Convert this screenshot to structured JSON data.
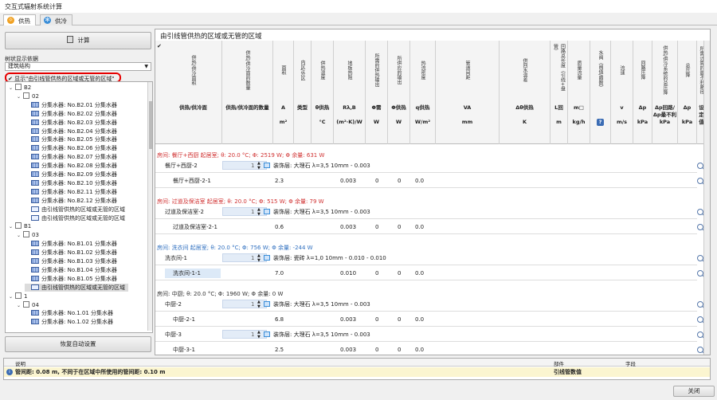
{
  "window": {
    "title": "交互式辐射系统计算"
  },
  "tabs": [
    {
      "label": "供热",
      "icon": "heating-icon",
      "color": "#f0a020"
    },
    {
      "label": "供冷",
      "icon": "snowflake-icon",
      "color": "#3b8ed8"
    }
  ],
  "left": {
    "calc_label": "计算",
    "display_label": "树状显示依据",
    "display_value": "建筑结构",
    "checkbox_label": "显示\"由引线管供热的区域或无管的区域\"",
    "restore_label": "恢复自动设置"
  },
  "tree": [
    {
      "level": 0,
      "icon": "floor",
      "label": "B2",
      "expanded": true
    },
    {
      "level": 1,
      "icon": "floor",
      "label": "02",
      "expanded": true
    },
    {
      "level": 2,
      "icon": "man",
      "label": "分集水器: No.B2.01 分集水器"
    },
    {
      "level": 2,
      "icon": "man",
      "label": "分集水器: No.B2.02 分集水器"
    },
    {
      "level": 2,
      "icon": "man",
      "label": "分集水器: No.B2.03 分集水器"
    },
    {
      "level": 2,
      "icon": "man",
      "label": "分集水器: No.B2.04 分集水器"
    },
    {
      "level": 2,
      "icon": "man",
      "label": "分集水器: No.B2.05 分集水器"
    },
    {
      "level": 2,
      "icon": "man",
      "label": "分集水器: No.B2.06 分集水器"
    },
    {
      "level": 2,
      "icon": "man",
      "label": "分集水器: No.B2.07 分集水器"
    },
    {
      "level": 2,
      "icon": "man",
      "label": "分集水器: No.B2.08 分集水器"
    },
    {
      "level": 2,
      "icon": "man",
      "label": "分集水器: No.B2.09 分集水器"
    },
    {
      "level": 2,
      "icon": "man",
      "label": "分集水器: No.B2.10 分集水器"
    },
    {
      "level": 2,
      "icon": "man",
      "label": "分集水器: No.B2.11 分集水器"
    },
    {
      "level": 2,
      "icon": "man",
      "label": "分集水器: No.B2.12 分集水器"
    },
    {
      "level": 2,
      "icon": "grp",
      "label": "由引线管供热的区域或无管的区域"
    },
    {
      "level": 2,
      "icon": "grp",
      "label": "由引线管供热的区域或无管的区域"
    },
    {
      "level": 0,
      "icon": "floor",
      "label": "B1",
      "expanded": true
    },
    {
      "level": 1,
      "icon": "floor",
      "label": "03",
      "expanded": true
    },
    {
      "level": 2,
      "icon": "man",
      "label": "分集水器: No.B1.01 分集水器"
    },
    {
      "level": 2,
      "icon": "man",
      "label": "分集水器: No.B1.02 分集水器"
    },
    {
      "level": 2,
      "icon": "man",
      "label": "分集水器: No.B1.03 分集水器"
    },
    {
      "level": 2,
      "icon": "man",
      "label": "分集水器: No.B1.04 分集水器"
    },
    {
      "level": 2,
      "icon": "man",
      "label": "分集水器: No.B1.05 分集水器"
    },
    {
      "level": 2,
      "icon": "grp",
      "label": "由引线管供热的区域或无管的区域",
      "selected": true
    },
    {
      "level": 0,
      "icon": "floor",
      "label": "1",
      "expanded": true
    },
    {
      "level": 1,
      "icon": "floor",
      "label": "04",
      "expanded": true
    },
    {
      "level": 2,
      "icon": "man",
      "label": "分集水器: No.1.01 分集水器"
    },
    {
      "level": 2,
      "icon": "man",
      "label": "分集水器: No.1.02 分集水器"
    }
  ],
  "main": {
    "title": "由引线管供热的区域或无管的区域"
  },
  "columns": [
    {
      "v": "供热/供冷面积",
      "s": "供热/供冷面",
      "u": ""
    },
    {
      "v": "供热/供冷面的数量",
      "s": "供热/供冷面的数量",
      "u": ""
    },
    {
      "v": "面积",
      "s": "A",
      "u": "m²"
    },
    {
      "v": "内区/外区",
      "s": "类型",
      "u": ""
    },
    {
      "v": "供热温度",
      "s": "θ供热",
      "u": "°C"
    },
    {
      "v": "地板热阻",
      "s": "Rλ,B",
      "u": "(m²·K)/W"
    },
    {
      "v": "所需的供热输出",
      "s": "Φ需",
      "u": "W"
    },
    {
      "v": "所供应的输出",
      "s": "Φ供热",
      "u": "W"
    },
    {
      "v": "热流密度",
      "s": "q供热",
      "u": "W/m²"
    },
    {
      "v": "管道间距",
      "s": "VA",
      "u": "mm"
    },
    {
      "v": "供回水温差",
      "s": "Δθ供热",
      "u": "K"
    },
    {
      "v": "回路总长度（引线+盘管）",
      "s": "L回",
      "u": "m"
    },
    {
      "v": "质量流量",
      "s": "m□",
      "u": "kg/h"
    },
    {
      "v": "水阀（阀值/圈数）",
      "s": "",
      "u": "?"
    },
    {
      "v": "流速",
      "s": "v",
      "u": "m/s"
    },
    {
      "v": "回路压降",
      "s": "Δp",
      "u": "kPa"
    },
    {
      "v": "供热/供冷系统的总压降",
      "s": "Δp回路/Δp最不利",
      "u": "kPa"
    },
    {
      "v": "总压降",
      "s": "Δp",
      "u": "kPa"
    },
    {
      "v": "所需计算的最不利路径",
      "s": "设定值",
      "u": ""
    }
  ],
  "rooms": [
    {
      "header": "房间: 餐厅+西厨 起居室; θ: 20.0 °C; Φ: 2519 W; Φ 余量: 631 W",
      "color": "#d03030",
      "rows": [
        {
          "name": "餐厅+西厨-2",
          "spin": "1",
          "mat": "装饰层: 大理石 λ=3,5 10mm - 0.003"
        },
        {
          "name": "餐厅+西厨-2-1",
          "area": "2.3",
          "r": "0.003",
          "a": "0",
          "b": "0",
          "c": "0.0"
        }
      ]
    },
    {
      "header": "房间: 过道及保洁室 起居室; θ: 20.0 °C; Φ: 515 W; Φ 余量: 79 W",
      "color": "#d03030",
      "rows": [
        {
          "name": "过道及保洁室-2",
          "spin": "1",
          "mat": "装饰层: 大理石 λ=3,5 10mm - 0.003"
        },
        {
          "name": "过道及保洁室-2-1",
          "area": "0.6",
          "r": "0.003",
          "a": "0",
          "b": "0",
          "c": "0.0"
        }
      ]
    },
    {
      "header": "房间: 洗衣间 起居室; θ: 20.0 °C; Φ: 756 W; Φ 余量: -244 W",
      "color": "#3070c0",
      "rows": [
        {
          "name": "洗衣间-1",
          "spin": "1",
          "mat": "装饰层: 瓷砖 λ=1,0 10mm - 0.010 - 0.010"
        },
        {
          "name": "洗衣间-1-1",
          "area": "7.0",
          "r": "0.010",
          "a": "0",
          "b": "0",
          "c": "0.0",
          "hl": true
        }
      ]
    },
    {
      "header": "房间: 中厨; θ: 20.0 °C; Φ: 1960 W; Φ 余量: 0 W",
      "color": "#333",
      "rows": [
        {
          "name": "中厨-2",
          "spin": "1",
          "mat": "装饰层: 大理石 λ=3,5 10mm - 0.003"
        },
        {
          "name": "中厨-2-1",
          "area": "6.8",
          "r": "0.003",
          "a": "0",
          "b": "0",
          "c": "0.0"
        },
        {
          "name": "中厨-3",
          "spin": "1",
          "mat": "装饰层: 大理石 λ=3,5 10mm - 0.003"
        },
        {
          "name": "中厨-3-1",
          "area": "2.5",
          "r": "0.003",
          "a": "0",
          "b": "0",
          "c": "0.0"
        }
      ]
    }
  ],
  "messages": {
    "headers": [
      "说明",
      "部件",
      "字段"
    ],
    "text": "管间距: 0.08 m, 不同于在区域中所使用的管间距: 0.10 m",
    "part": "引线管数值"
  },
  "close_label": "关闭",
  "colors": {
    "highlight": "#e60000",
    "accent": "#3b8ed8"
  }
}
